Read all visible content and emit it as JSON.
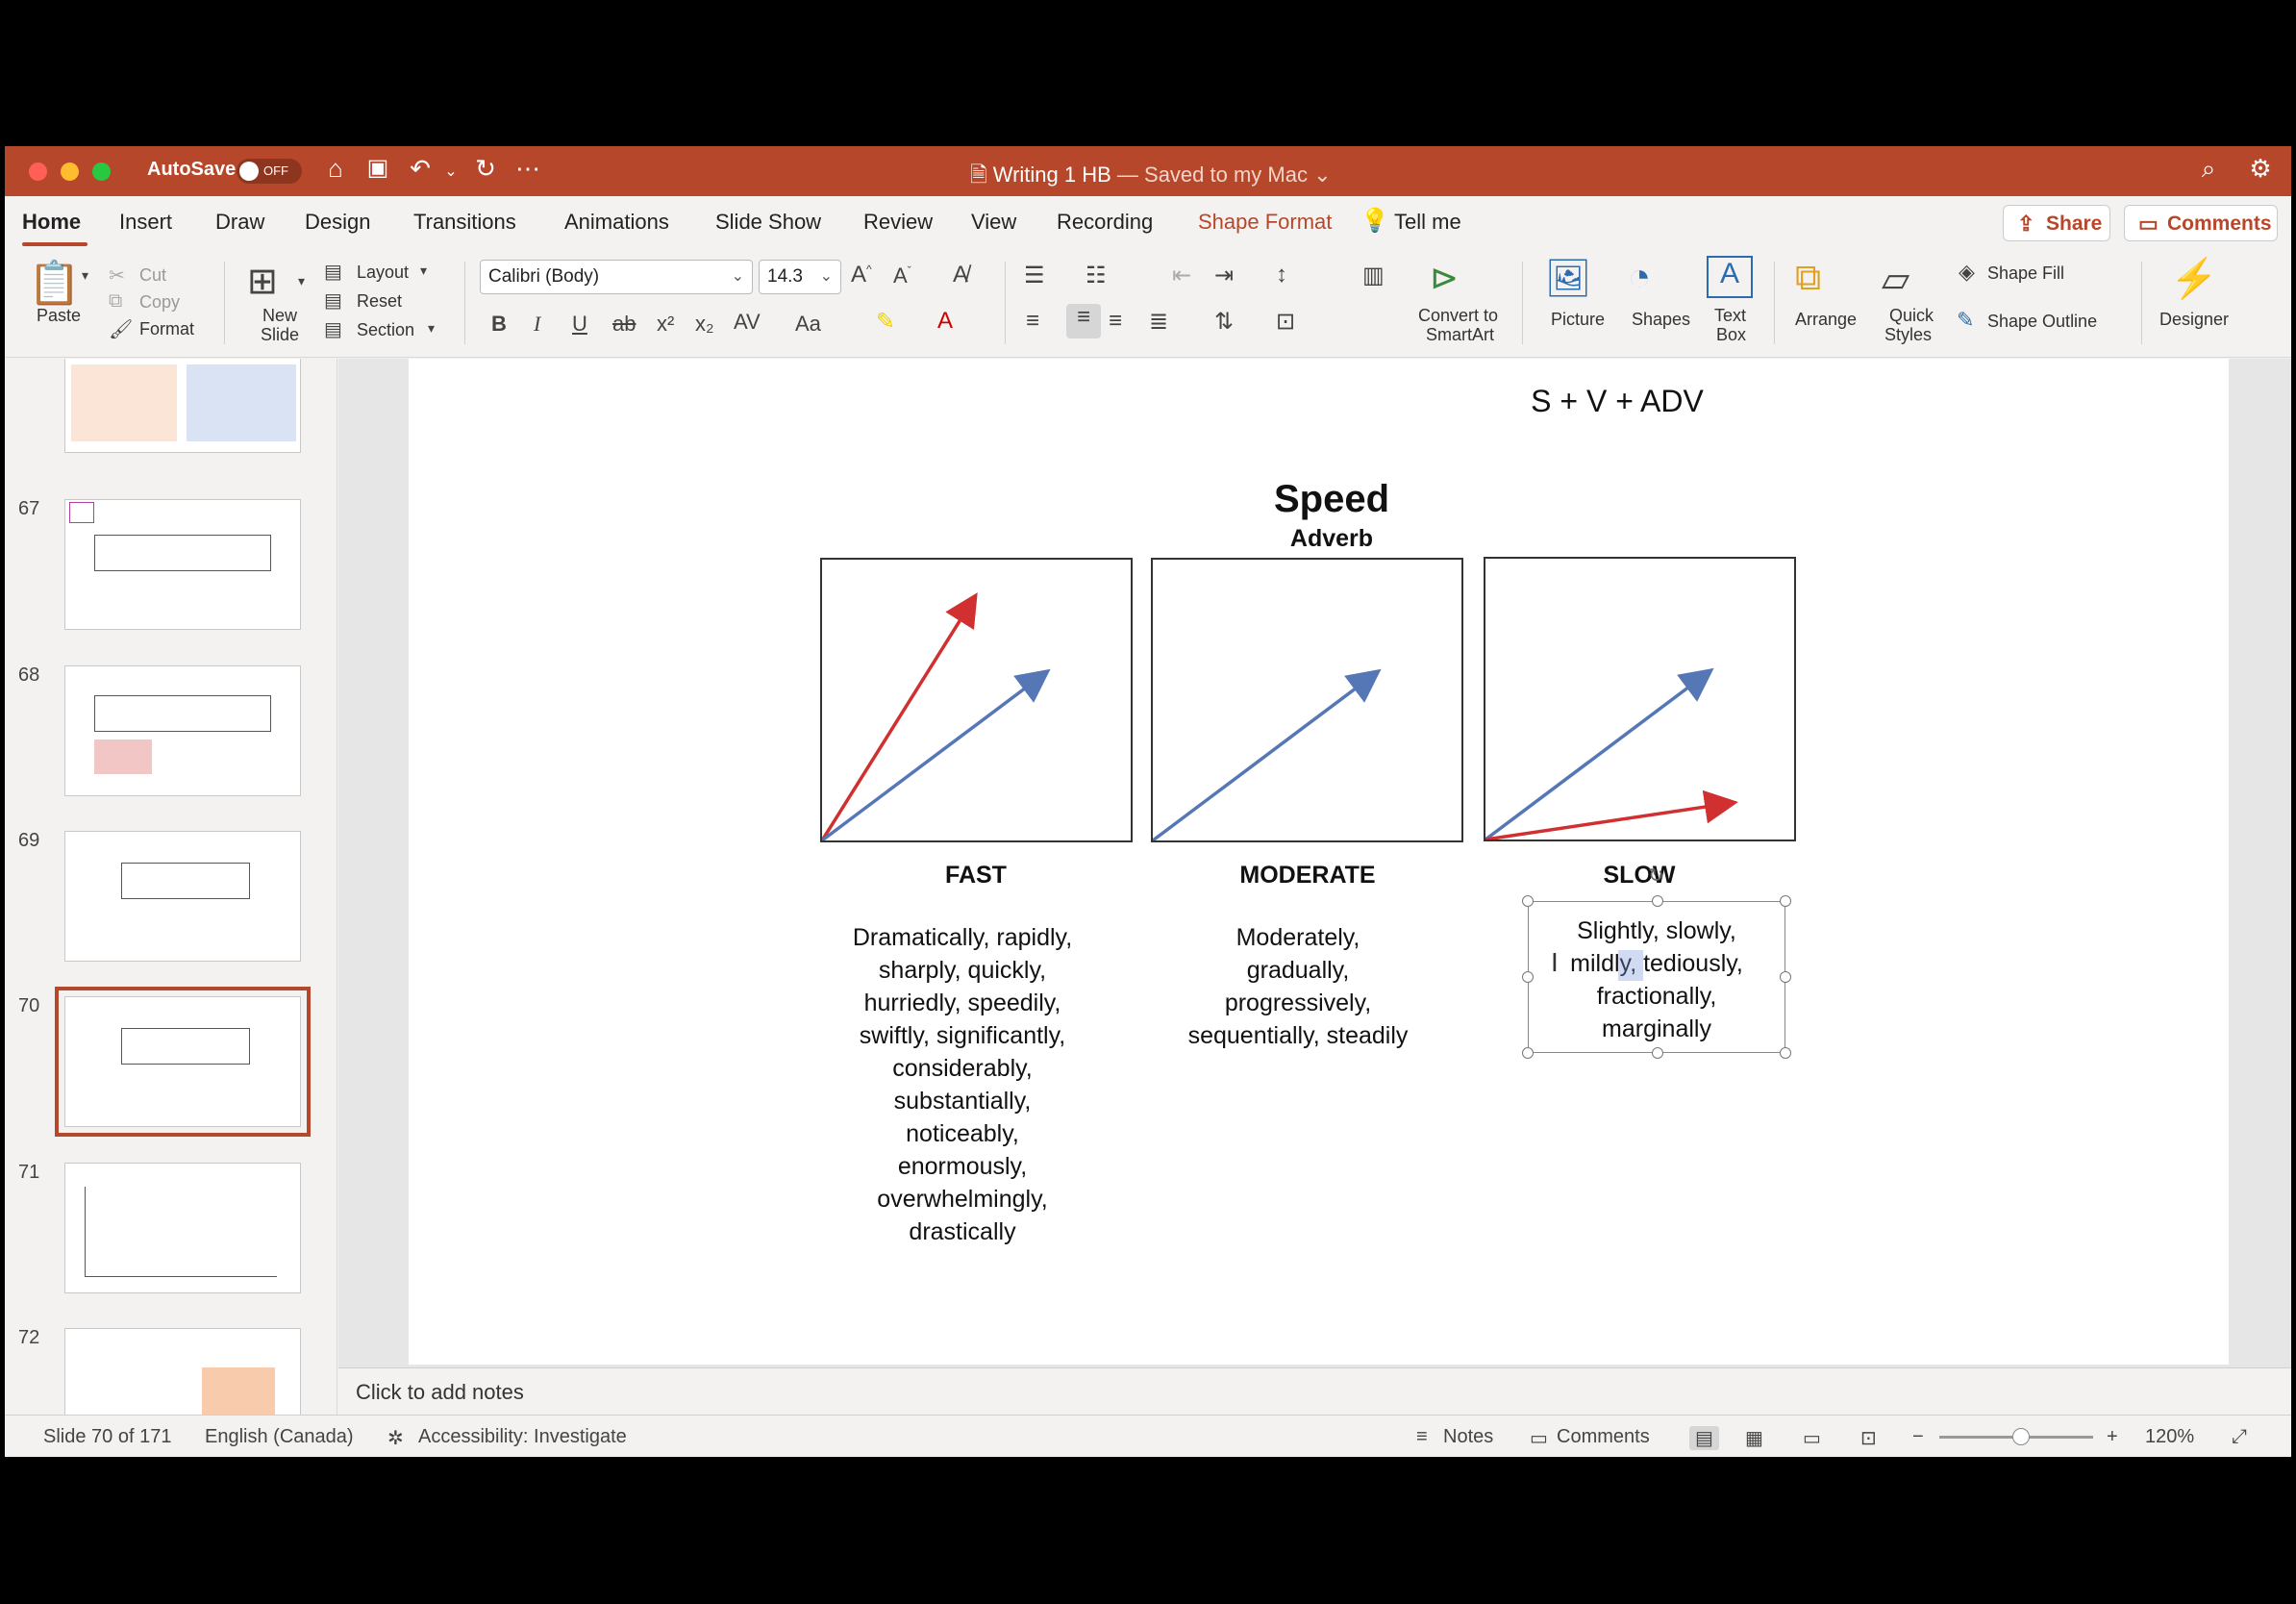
{
  "window": {
    "autosave_label": "AutoSave",
    "autosave_state": "OFF",
    "doc_name": "Writing 1 HB",
    "doc_status": "— Saved to my Mac",
    "doc_chevron": "⌄"
  },
  "tabs": [
    "Home",
    "Insert",
    "Draw",
    "Design",
    "Transitions",
    "Animations",
    "Slide Show",
    "Review",
    "View",
    "Recording",
    "Shape Format",
    "Tell me"
  ],
  "share_label": "Share",
  "comments_label": "Comments",
  "ribbon": {
    "paste": "Paste",
    "cut": "Cut",
    "copy": "Copy",
    "format": "Format",
    "new_slide_1": "New",
    "new_slide_2": "Slide",
    "layout": "Layout",
    "reset": "Reset",
    "section": "Section",
    "font_name": "Calibri (Body)",
    "font_size": "14.3",
    "convert_1": "Convert to",
    "convert_2": "SmartArt",
    "picture": "Picture",
    "shapes": "Shapes",
    "textbox_1": "Text",
    "textbox_2": "Box",
    "arrange": "Arrange",
    "quick_1": "Quick",
    "quick_2": "Styles",
    "shape_fill": "Shape Fill",
    "shape_outline": "Shape Outline",
    "designer": "Designer"
  },
  "sidebar": {
    "slides": [
      {
        "num": "67"
      },
      {
        "num": "68"
      },
      {
        "num": "69"
      },
      {
        "num": "70"
      },
      {
        "num": "71"
      },
      {
        "num": "72"
      }
    ]
  },
  "slide": {
    "formula": "S + V + ADV",
    "title": "Speed",
    "subtitle": "Adverb",
    "columns": [
      {
        "heading": "FAST",
        "lines": [
          "Dramatically, rapidly,",
          "sharply, quickly,",
          "hurriedly, speedily,",
          "swiftly, significantly,",
          "considerably,",
          "substantially,",
          "noticeably,",
          "enormously,",
          "overwhelmingly,",
          "drastically"
        ]
      },
      {
        "heading": "MODERATE",
        "lines": [
          "Moderately,",
          "gradually,",
          "progressively,",
          "sequentially, steadily"
        ]
      },
      {
        "heading": "SLOW",
        "lines": [
          "Slightly, slowly,",
          "mildly, tediously,",
          "fractionally,",
          "marginally"
        ]
      }
    ],
    "colors": {
      "red": "#d03030",
      "blue": "#5577b5"
    }
  },
  "notes_placeholder": "Click to add notes",
  "status": {
    "slide_count": "Slide 70 of 171",
    "language": "English (Canada)",
    "accessibility": "Accessibility: Investigate",
    "notes": "Notes",
    "comments": "Comments",
    "zoom": "120%"
  }
}
